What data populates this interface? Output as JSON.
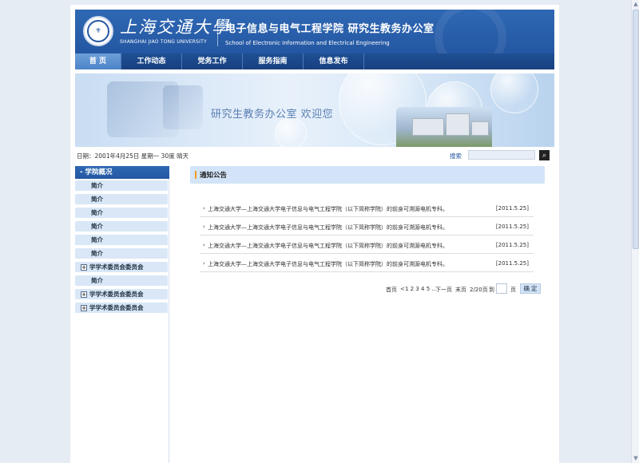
{
  "header": {
    "university_cn": "上海交通大學",
    "university_en": "SHANGHAI JIAO TONG UNIVERSITY",
    "school_cn": "电子信息与电气工程学院  研究生教务办公室",
    "school_en": "School of Electronic Information and Electrical Engineering",
    "colors": {
      "header_bg": "#2457a2",
      "nav_bg": "#1f4f93",
      "nav_active": "#5a8fd0"
    }
  },
  "nav": {
    "items": [
      {
        "label": "首 页",
        "active": true
      },
      {
        "label": "工作动态"
      },
      {
        "label": "党务工作"
      },
      {
        "label": "服务指南"
      },
      {
        "label": "信息发布"
      }
    ]
  },
  "banner": {
    "text": "研究生教务办公室  欢迎您"
  },
  "info_bar": {
    "date": "日期：2001年4月25日 星期一 30度 晴天",
    "search_label": "搜索",
    "search_value": "",
    "search_button_icon": "search-icon"
  },
  "sidebar": {
    "header": "- 学院概况",
    "items": [
      {
        "label": "简介",
        "type": "plain"
      },
      {
        "label": "简介",
        "type": "plain"
      },
      {
        "label": "简介",
        "type": "plain"
      },
      {
        "label": "简介",
        "type": "plain"
      },
      {
        "label": "简介",
        "type": "plain"
      },
      {
        "label": "简介",
        "type": "plain"
      },
      {
        "label": "学学术委员会委员会",
        "type": "expand"
      },
      {
        "label": "简介",
        "type": "plain"
      },
      {
        "label": "学学术委员会委员会",
        "type": "expand"
      },
      {
        "label": "学学术委员会委员会",
        "type": "expand"
      }
    ]
  },
  "main": {
    "section_title": "通知公告",
    "news": [
      {
        "title": "上海交通大学—上海交通大学电子信息与电气工程学院（以下简称学院）的前身可溯源电机专科。",
        "date": "[2011.5.25]"
      },
      {
        "title": "上海交通大学—上海交通大学电子信息与电气工程学院（以下简称学院）的前身可溯源电机专科。",
        "date": "[2011.5.25]"
      },
      {
        "title": "上海交通大学—上海交通大学电子信息与电气工程学院（以下简称学院）的前身可溯源电机专科。",
        "date": "[2011.5.25]"
      },
      {
        "title": "上海交通大学—上海交通大学电子信息与电气工程学院（以下简称学院）的前身可溯源电机专科。",
        "date": "[2011.5.25]"
      }
    ],
    "pager": {
      "first": "首页",
      "prev": "<",
      "pages": "1 2 3 4 5 ...",
      "next": "下一页",
      "last": "末页",
      "page_info": "2/20页",
      "goto_label": "到",
      "page_unit": "页",
      "goto_value": "",
      "confirm": "确 定"
    }
  }
}
